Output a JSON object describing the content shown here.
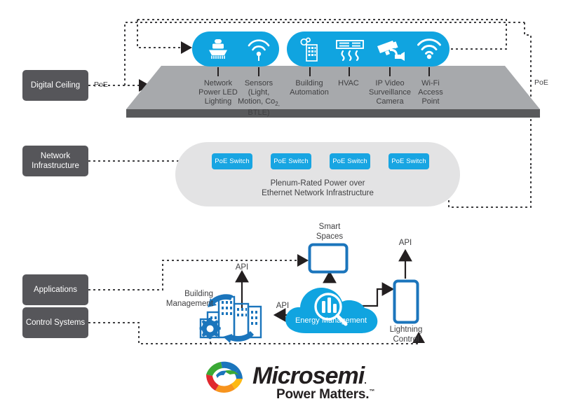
{
  "colors": {
    "brand_blue": "#10a4e0",
    "deep_blue": "#1b75bc",
    "layer_box_gray": "#56565a",
    "platform_top": "#a7a9ac",
    "platform_edge": "#58595b",
    "infra_blob": "#e3e3e4",
    "line_dark": "#231f20",
    "logo_green": "#3aa935",
    "logo_blue": "#1b75bc",
    "logo_red": "#e0282e",
    "logo_orange": "#f7941e",
    "logo_yellow": "#fdb913"
  },
  "layers": [
    {
      "id": "digital-ceiling",
      "label": "Digital Ceiling"
    },
    {
      "id": "network-infrastructure",
      "label": "Network Infrastructure"
    },
    {
      "id": "applications",
      "label": "Applications"
    },
    {
      "id": "control-systems",
      "label": "Control Systems"
    }
  ],
  "poe_labels": {
    "left": "PoE",
    "right": "PoE"
  },
  "ceiling": {
    "group_a": [
      {
        "icon": "led-lighting-icon",
        "label": "Network\nPower LED\nLighting",
        "lines": [
          "Network",
          "Power LED",
          "Lighting"
        ]
      },
      {
        "icon": "wifi-sensor-icon",
        "label": "Sensors (Light, Motion, Co2, BTLE)",
        "lines": [
          "Sensors",
          "(Light,",
          "Motion, Co",
          "BTLE)"
        ],
        "sub": "2,"
      }
    ],
    "group_b": [
      {
        "icon": "building-automation-icon",
        "lines": [
          "Building",
          "Automation"
        ]
      },
      {
        "icon": "hvac-icon",
        "lines": [
          "HVAC"
        ]
      },
      {
        "icon": "cctv-camera-icon",
        "lines": [
          "IP Video",
          "Surveillance",
          "Camera"
        ]
      },
      {
        "icon": "wifi-icon",
        "lines": [
          "Wi-Fi",
          "Access",
          "Point"
        ]
      }
    ]
  },
  "infrastructure": {
    "switches": [
      "PoE Switch",
      "PoE Switch",
      "PoE Switch",
      "PoE Switch"
    ],
    "caption_line1": "Plenum-Rated Power over",
    "caption_line2": "Ethernet Network Infrastructure"
  },
  "applications": {
    "smart_spaces": {
      "line1": "Smart",
      "line2": "Spaces"
    },
    "building_management": {
      "line1": "Building",
      "line2": "Management"
    },
    "energy_management": "Energy Management",
    "lightning_control": {
      "line1": "Lightning",
      "line2": "Control"
    },
    "api_top_left": "API",
    "api_mid": "API",
    "api_right": "API"
  },
  "logo": {
    "wordmark": "Microsemi",
    "registered": ".",
    "tagline": "Power Matters.",
    "tagline_tm": "™"
  }
}
